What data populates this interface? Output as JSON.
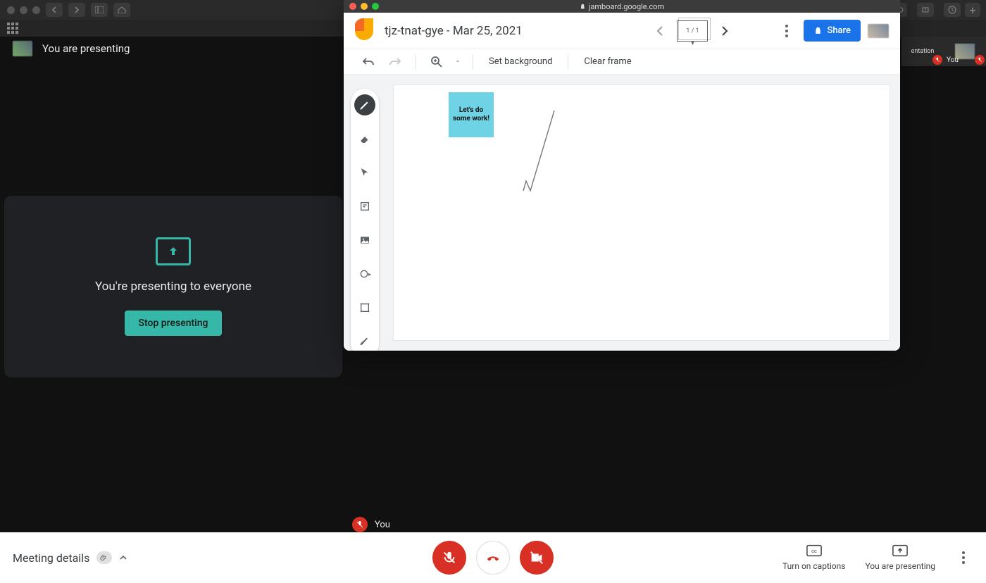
{
  "os": {
    "url": "jamboard.google.com"
  },
  "meet": {
    "presenting_banner": "You are presenting",
    "presenting_card_text": "You're presenting to everyone",
    "stop_button": "Stop presenting",
    "self_label": "You",
    "meeting_details": "Meeting details",
    "captions": "Turn on captions",
    "you_are_presenting": "You are presenting",
    "thumb_presentation": "entation",
    "thumb_you": "You"
  },
  "jamboard": {
    "url": "jamboard.google.com",
    "title": "tjz-tnat-gye - Mar 25, 2021",
    "frame_indicator": "1 / 1",
    "share": "Share",
    "set_background": "Set background",
    "clear_frame": "Clear frame",
    "zoom_dash": "-",
    "sticky_text": "Let's do some work!"
  }
}
